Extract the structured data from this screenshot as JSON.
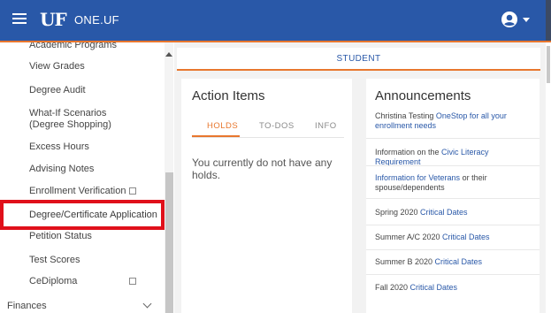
{
  "header": {
    "logo": "UF",
    "app_title": "ONE.UF"
  },
  "sidebar": {
    "items": [
      {
        "label": "Academic Programs"
      },
      {
        "label": "View Grades"
      },
      {
        "label": "Degree Audit"
      },
      {
        "label": "What-If Scenarios (Degree Shopping)"
      },
      {
        "label": "Excess Hours"
      },
      {
        "label": "Advising Notes"
      },
      {
        "label": "Enrollment Verification",
        "external": true
      },
      {
        "label": "Degree/Certificate Application",
        "highlighted": true
      },
      {
        "label": "Petition Status"
      },
      {
        "label": "Test Scores"
      },
      {
        "label": "CeDiploma",
        "external": true
      },
      {
        "label": "Finances",
        "expandable": true
      }
    ]
  },
  "main": {
    "section_label": "STUDENT",
    "action_items": {
      "title": "Action Items",
      "tabs": [
        {
          "label": "HOLDS",
          "active": true
        },
        {
          "label": "TO-DOS",
          "active": false
        },
        {
          "label": "INFO",
          "active": false
        }
      ],
      "empty_message": "You currently do not have any holds."
    },
    "announcements": {
      "title": "Announcements",
      "items": [
        {
          "pre": "Christina Testing ",
          "link": "OneStop for all your enrollment needs",
          "post": ""
        },
        {
          "pre": "Information on the ",
          "link": "Civic Literacy Requirement",
          "post": ""
        },
        {
          "pre": "",
          "link": "Information for Veterans",
          "post": " or their spouse/dependents"
        },
        {
          "pre": "Spring 2020 ",
          "link": "Critical Dates",
          "post": ""
        },
        {
          "pre": "Summer A/C 2020 ",
          "link": "Critical Dates",
          "post": ""
        },
        {
          "pre": "Summer B 2020 ",
          "link": "Critical Dates",
          "post": ""
        },
        {
          "pre": "Fall 2020 ",
          "link": "Critical Dates",
          "post": ""
        }
      ]
    }
  },
  "colors": {
    "header_bg": "#2958a8",
    "accent_orange": "#e8772e",
    "highlight_red": "#e0101a",
    "link_blue": "#2958a8"
  }
}
